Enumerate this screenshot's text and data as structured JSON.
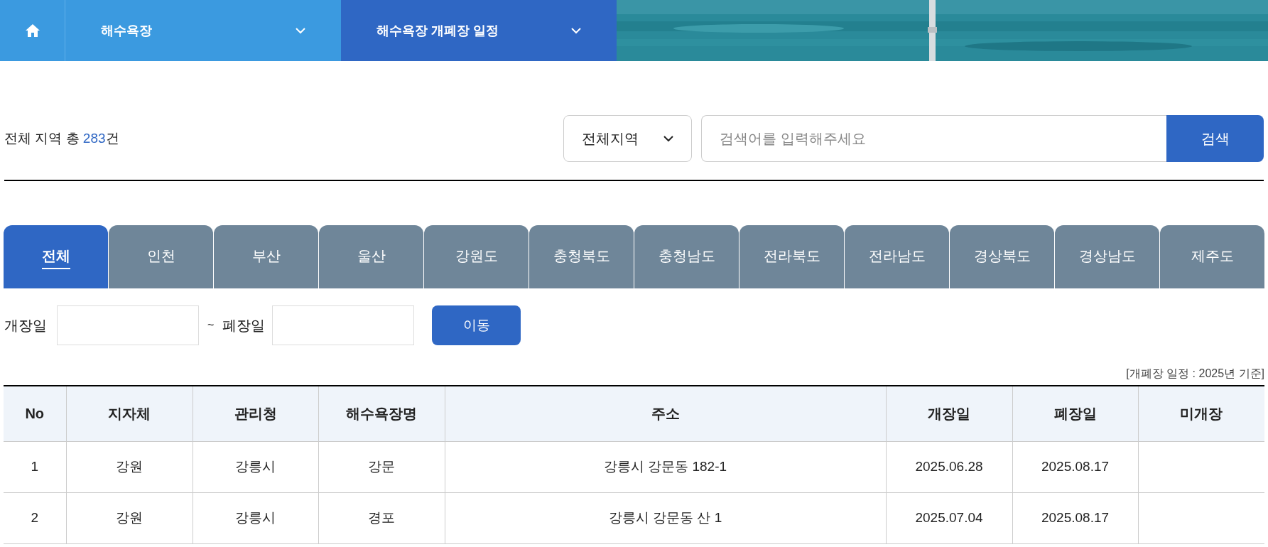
{
  "nav": {
    "items": [
      {
        "kind": "home"
      },
      {
        "kind": "dropdown",
        "label": "해수욕장"
      },
      {
        "kind": "dropdown",
        "label": "해수욕장 개폐장 일정"
      }
    ]
  },
  "summary": {
    "prefix": "전체 지역 총 ",
    "count": "283",
    "suffix": "건"
  },
  "search": {
    "region": "전체지역",
    "placeholder": "검색어를 입력해주세요",
    "button": "검색"
  },
  "tabs": [
    {
      "label": "전체",
      "selected": true
    },
    {
      "label": "인천",
      "selected": false
    },
    {
      "label": "부산",
      "selected": false
    },
    {
      "label": "울산",
      "selected": false
    },
    {
      "label": "강원도",
      "selected": false
    },
    {
      "label": "충청북도",
      "selected": false
    },
    {
      "label": "충청남도",
      "selected": false
    },
    {
      "label": "전라북도",
      "selected": false
    },
    {
      "label": "전라남도",
      "selected": false
    },
    {
      "label": "경상북도",
      "selected": false
    },
    {
      "label": "경상남도",
      "selected": false
    },
    {
      "label": "제주도",
      "selected": false
    }
  ],
  "date_filter": {
    "open_label": "개장일",
    "separator": "~",
    "close_label": "폐장일",
    "button": "이동"
  },
  "note": "[개폐장 일정 : 2025년 기준]",
  "table": {
    "columns": [
      "No",
      "지자체",
      "관리청",
      "해수욕장명",
      "주소",
      "개장일",
      "폐장일",
      "미개장"
    ],
    "rows": [
      [
        "1",
        "강원",
        "강릉시",
        "강문",
        "강릉시 강문동 182-1",
        "2025.06.28",
        "2025.08.17",
        null
      ],
      [
        "2",
        "강원",
        "강릉시",
        "경포",
        "강릉시 강문동 산 1",
        "2025.07.04",
        "2025.08.17",
        null
      ]
    ]
  }
}
